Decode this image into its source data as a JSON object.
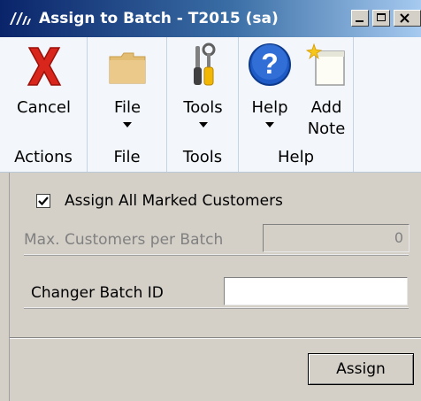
{
  "window": {
    "title": "Assign to Batch  -  T2015 (sa)"
  },
  "ribbon": {
    "groups": [
      {
        "label": "Actions",
        "buttons": [
          {
            "label": "Cancel",
            "icon": "cancel-x-icon"
          }
        ]
      },
      {
        "label": "File",
        "buttons": [
          {
            "label": "File",
            "icon": "folder-icon"
          }
        ]
      },
      {
        "label": "Tools",
        "buttons": [
          {
            "label": "Tools",
            "icon": "tools-icon"
          }
        ]
      },
      {
        "label": "Help",
        "buttons": [
          {
            "label": "Help",
            "icon": "help-icon"
          },
          {
            "label": "Add",
            "label2": "Note",
            "icon": "add-note-icon"
          }
        ]
      }
    ]
  },
  "form": {
    "assign_all_label": "Assign All Marked Customers",
    "assign_all_checked": true,
    "max_customers_label": "Max. Customers per Batch",
    "max_customers_value": "0",
    "batch_id_label": "Changer Batch ID",
    "batch_id_value": "",
    "assign_button": "Assign"
  },
  "colors": {
    "title_start": "#0a246a",
    "title_end": "#a6caf0",
    "ribbon_bg": "#f3f7fb",
    "form_bg": "#d4d0c8",
    "cancel_red": "#d9261c",
    "help_blue": "#1e5bc6"
  }
}
